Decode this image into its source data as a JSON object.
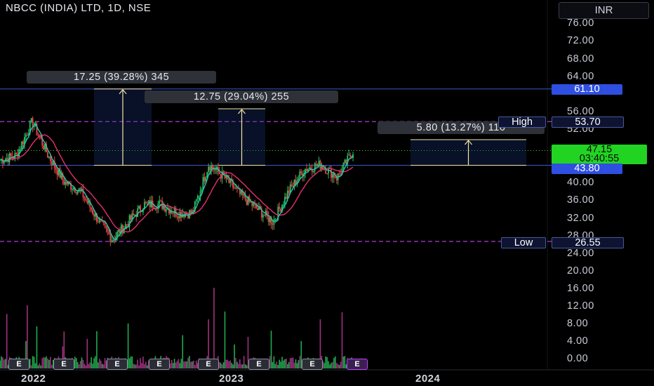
{
  "header": {
    "title": "NBCC (INDIA) LTD, 1D, NSE",
    "currency": "INR"
  },
  "price_axis": [
    "76.00",
    "72.00",
    "68.00",
    "64.00",
    "56.00",
    "52.00",
    "40.00",
    "36.00",
    "32.00",
    "28.00",
    "24.00",
    "20.00",
    "16.00",
    "12.00",
    "8.00",
    "4.00",
    "0.00"
  ],
  "price_tags": {
    "level_top": "61.10",
    "high_value": "53.70",
    "current_price": "47.15",
    "countdown": "03:40:55",
    "level_support": "43.80",
    "low_value": "26.55",
    "high_label": "High",
    "low_label": "Low"
  },
  "measurements": {
    "m1": "17.25 (39.28%) 345",
    "m2": "12.75 (29.04%) 255",
    "m3": "5.80 (13.27%) 116"
  },
  "time_axis": [
    "2022",
    "2023",
    "2024"
  ],
  "events": [
    "E",
    "E",
    "E",
    "E",
    "E",
    "E",
    "E",
    "E",
    "E",
    "E"
  ],
  "colors": {
    "up": "#26a69a",
    "down": "#ef5350",
    "bull_candle": "#22c55e",
    "bear_candle": "#ef4444",
    "ma_fast": "#2ec4b6",
    "ma_slow": "#e5306e",
    "level_line": "#3a56d4",
    "high_low_line": "#b03ad8",
    "current_price": "#2fe02f",
    "arrow": "#f5e6a8"
  },
  "chart_data": {
    "type": "candlestick",
    "title": "NBCC (INDIA) LTD, 1D, NSE",
    "price_range": [
      0,
      78
    ],
    "levels": {
      "resistance": 61.1,
      "high": 53.7,
      "current": 47.15,
      "support": 43.8,
      "low": 26.55
    },
    "price_path": [
      {
        "date": "2021-11",
        "close": 45
      },
      {
        "date": "2021-12",
        "close": 46
      },
      {
        "date": "2022-01",
        "close": 53.7
      },
      {
        "date": "2022-02",
        "close": 46
      },
      {
        "date": "2022-03",
        "close": 40
      },
      {
        "date": "2022-04",
        "close": 38
      },
      {
        "date": "2022-05",
        "close": 32
      },
      {
        "date": "2022-06",
        "close": 27
      },
      {
        "date": "2022-07",
        "close": 31
      },
      {
        "date": "2022-08",
        "close": 35
      },
      {
        "date": "2022-09",
        "close": 35
      },
      {
        "date": "2022-10",
        "close": 33
      },
      {
        "date": "2022-11",
        "close": 33
      },
      {
        "date": "2022-12",
        "close": 44
      },
      {
        "date": "2023-01",
        "close": 41
      },
      {
        "date": "2023-02",
        "close": 37
      },
      {
        "date": "2023-03",
        "close": 34
      },
      {
        "date": "2023-04",
        "close": 31
      },
      {
        "date": "2023-05",
        "close": 38
      },
      {
        "date": "2023-06",
        "close": 43
      },
      {
        "date": "2023-07",
        "close": 44
      },
      {
        "date": "2023-08",
        "close": 41
      },
      {
        "date": "2023-09",
        "close": 47
      }
    ]
  }
}
